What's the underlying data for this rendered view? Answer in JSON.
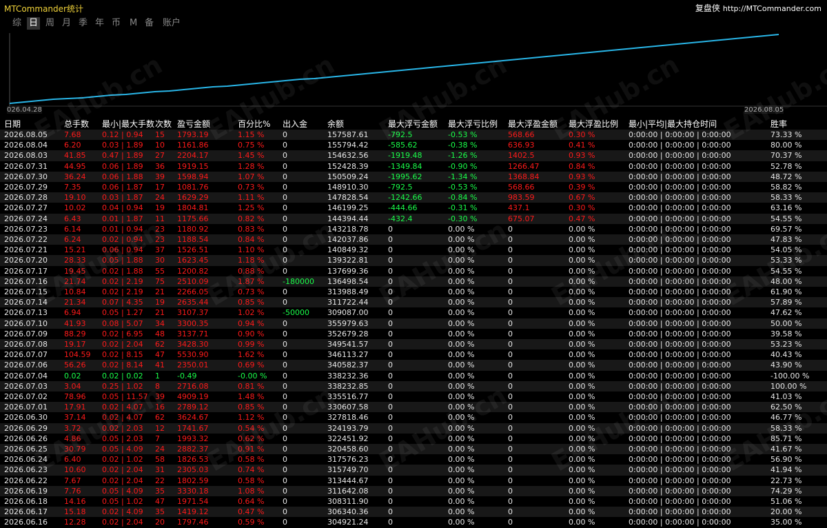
{
  "app": {
    "title": "MTCommander统计",
    "brand": "复盘侠",
    "url": "http://MTCommander.com"
  },
  "tabs": [
    {
      "label": "综",
      "active": false
    },
    {
      "label": "日",
      "active": true
    },
    {
      "label": "周",
      "active": false
    },
    {
      "label": "月",
      "active": false
    },
    {
      "label": "季",
      "active": false
    },
    {
      "label": "年",
      "active": false
    },
    {
      "label": "币",
      "active": false
    },
    {
      "label": "M",
      "active": false
    },
    {
      "label": "备",
      "active": false
    },
    {
      "label": "账户",
      "active": false
    }
  ],
  "chart_data": {
    "type": "line",
    "x_start_label": "026.04.28",
    "x_end_label": "2026.08.05",
    "series": [
      {
        "values": [
          0,
          2,
          4,
          6,
          7,
          8,
          10,
          12,
          13,
          15,
          17,
          18,
          20,
          22,
          24,
          25,
          27,
          29,
          31,
          33,
          35,
          36,
          38,
          40,
          42,
          44,
          46,
          48,
          50,
          52,
          54,
          56,
          58,
          60,
          62,
          64,
          66,
          68,
          70,
          72,
          74,
          76,
          78,
          80,
          82,
          84,
          86,
          88,
          90,
          92,
          94,
          96,
          98,
          100
        ]
      }
    ],
    "line_color": "#29b6e8"
  },
  "columns": [
    "日期",
    "总手数",
    "最小|最大手数",
    "次数",
    "盈亏金额",
    "百分比%",
    "出入金",
    "余额",
    "最大浮亏金额",
    "最大浮亏比例",
    "最大浮盈金额",
    "最大浮盈比例",
    "最小|平均|最大持仓时间",
    "胜率"
  ],
  "rows": [
    {
      "date": "2026.08.05",
      "lots": "7.68",
      "minmax": "0.12 | 0.94",
      "count": "15",
      "pnl": "1793.19",
      "pct": "1.15 %",
      "dep": "0",
      "bal": "157587.61",
      "ddAmt": "-792.5",
      "ddPct": "-0.53 %",
      "fpAmt": "568.66",
      "fpPct": "0.30 %",
      "hold": "0:00:00 | 0:00:00 | 0:00:00",
      "win": "73.33 %",
      "c": "red",
      "f": "red"
    },
    {
      "date": "2026.08.04",
      "lots": "6.20",
      "minmax": "0.03 | 1.89",
      "count": "10",
      "pnl": "1161.86",
      "pct": "0.75 %",
      "dep": "0",
      "bal": "155794.42",
      "ddAmt": "-585.62",
      "ddPct": "-0.38 %",
      "fpAmt": "636.93",
      "fpPct": "0.41 %",
      "hold": "0:00:00 | 0:00:00 | 0:00:00",
      "win": "80.00 %",
      "c": "red",
      "f": "red"
    },
    {
      "date": "2026.08.03",
      "lots": "41.85",
      "minmax": "0.47 | 1.89",
      "count": "27",
      "pnl": "2204.17",
      "pct": "1.45 %",
      "dep": "0",
      "bal": "154632.56",
      "ddAmt": "-1919.48",
      "ddPct": "-1.26 %",
      "fpAmt": "1402.5",
      "fpPct": "0.93 %",
      "hold": "0:00:00 | 0:00:00 | 0:00:00",
      "win": "70.37 %",
      "c": "red",
      "f": "red"
    },
    {
      "date": "2026.07.31",
      "lots": "44.95",
      "minmax": "0.06 | 1.89",
      "count": "36",
      "pnl": "1919.15",
      "pct": "1.28 %",
      "dep": "0",
      "bal": "152428.39",
      "ddAmt": "-1349.84",
      "ddPct": "-0.90 %",
      "fpAmt": "1266.47",
      "fpPct": "0.84 %",
      "hold": "0:00:00 | 0:00:00 | 0:00:00",
      "win": "52.78 %",
      "c": "red",
      "f": "red"
    },
    {
      "date": "2026.07.30",
      "lots": "36.24",
      "minmax": "0.06 | 1.88",
      "count": "39",
      "pnl": "1598.94",
      "pct": "1.07 %",
      "dep": "0",
      "bal": "150509.24",
      "ddAmt": "-1995.62",
      "ddPct": "-1.34 %",
      "fpAmt": "1368.84",
      "fpPct": "0.93 %",
      "hold": "0:00:00 | 0:00:00 | 0:00:00",
      "win": "48.72 %",
      "c": "red",
      "f": "red"
    },
    {
      "date": "2026.07.29",
      "lots": "7.35",
      "minmax": "0.06 | 1.87",
      "count": "17",
      "pnl": "1081.76",
      "pct": "0.73 %",
      "dep": "0",
      "bal": "148910.30",
      "ddAmt": "-792.5",
      "ddPct": "-0.53 %",
      "fpAmt": "568.66",
      "fpPct": "0.39 %",
      "hold": "0:00:00 | 0:00:00 | 0:00:00",
      "win": "58.82 %",
      "c": "red",
      "f": "red"
    },
    {
      "date": "2026.07.28",
      "lots": "19.10",
      "minmax": "0.03 | 1.87",
      "count": "24",
      "pnl": "1629.29",
      "pct": "1.11 %",
      "dep": "0",
      "bal": "147828.54",
      "ddAmt": "-1242.66",
      "ddPct": "-0.84 %",
      "fpAmt": "983.59",
      "fpPct": "0.67 %",
      "hold": "0:00:00 | 0:00:00 | 0:00:00",
      "win": "58.33 %",
      "c": "red",
      "f": "red"
    },
    {
      "date": "2026.07.27",
      "lots": "10.02",
      "minmax": "0.04 | 0.94",
      "count": "19",
      "pnl": "1804.81",
      "pct": "1.25 %",
      "dep": "0",
      "bal": "146199.25",
      "ddAmt": "-444.66",
      "ddPct": "-0.31 %",
      "fpAmt": "437.1",
      "fpPct": "0.30 %",
      "hold": "0:00:00 | 0:00:00 | 0:00:00",
      "win": "63.16 %",
      "c": "red",
      "f": "red"
    },
    {
      "date": "2026.07.24",
      "lots": "6.43",
      "minmax": "0.01 | 1.87",
      "count": "11",
      "pnl": "1175.66",
      "pct": "0.82 %",
      "dep": "0",
      "bal": "144394.44",
      "ddAmt": "-432.4",
      "ddPct": "-0.30 %",
      "fpAmt": "675.07",
      "fpPct": "0.47 %",
      "hold": "0:00:00 | 0:00:00 | 0:00:00",
      "win": "54.55 %",
      "c": "red",
      "f": "red"
    },
    {
      "date": "2026.07.23",
      "lots": "6.14",
      "minmax": "0.01 | 0.94",
      "count": "23",
      "pnl": "1180.92",
      "pct": "0.83 %",
      "dep": "0",
      "bal": "143218.78",
      "ddAmt": "0",
      "ddPct": "0.00 %",
      "fpAmt": "0",
      "fpPct": "0.00 %",
      "hold": "0:00:00 | 0:00:00 | 0:00:00",
      "win": "69.57 %",
      "c": "red",
      "f": "white"
    },
    {
      "date": "2026.07.22",
      "lots": "6.24",
      "minmax": "0.02 | 0.94",
      "count": "23",
      "pnl": "1188.54",
      "pct": "0.84 %",
      "dep": "0",
      "bal": "142037.86",
      "ddAmt": "0",
      "ddPct": "0.00 %",
      "fpAmt": "0",
      "fpPct": "0.00 %",
      "hold": "0:00:00 | 0:00:00 | 0:00:00",
      "win": "47.83 %",
      "c": "red",
      "f": "white"
    },
    {
      "date": "2026.07.21",
      "lots": "15.21",
      "minmax": "0.06 | 0.94",
      "count": "37",
      "pnl": "1526.51",
      "pct": "1.10 %",
      "dep": "0",
      "bal": "140849.32",
      "ddAmt": "0",
      "ddPct": "0.00 %",
      "fpAmt": "0",
      "fpPct": "0.00 %",
      "hold": "0:00:00 | 0:00:00 | 0:00:00",
      "win": "54.05 %",
      "c": "red",
      "f": "white"
    },
    {
      "date": "2026.07.20",
      "lots": "28.33",
      "minmax": "0.05 | 1.88",
      "count": "30",
      "pnl": "1623.45",
      "pct": "1.18 %",
      "dep": "0",
      "bal": "139322.81",
      "ddAmt": "0",
      "ddPct": "0.00 %",
      "fpAmt": "0",
      "fpPct": "0.00 %",
      "hold": "0:00:00 | 0:00:00 | 0:00:00",
      "win": "53.33 %",
      "c": "red",
      "f": "white"
    },
    {
      "date": "2026.07.17",
      "lots": "19.45",
      "minmax": "0.02 | 1.88",
      "count": "55",
      "pnl": "1200.82",
      "pct": "0.88 %",
      "dep": "0",
      "bal": "137699.36",
      "ddAmt": "0",
      "ddPct": "0.00 %",
      "fpAmt": "0",
      "fpPct": "0.00 %",
      "hold": "0:00:00 | 0:00:00 | 0:00:00",
      "win": "54.55 %",
      "c": "red",
      "f": "white"
    },
    {
      "date": "2026.07.16",
      "lots": "21.74",
      "minmax": "0.02 | 2.19",
      "count": "75",
      "pnl": "2510.09",
      "pct": "1.87 %",
      "dep": "-180000",
      "bal": "136498.54",
      "ddAmt": "0",
      "ddPct": "0.00 %",
      "fpAmt": "0",
      "fpPct": "0.00 %",
      "hold": "0:00:00 | 0:00:00 | 0:00:00",
      "win": "48.00 %",
      "c": "red",
      "f": "white",
      "depColor": "green"
    },
    {
      "date": "2026.07.15",
      "lots": "10.84",
      "minmax": "0.02 | 2.19",
      "count": "21",
      "pnl": "2266.05",
      "pct": "0.73 %",
      "dep": "0",
      "bal": "313988.49",
      "ddAmt": "0",
      "ddPct": "0.00 %",
      "fpAmt": "0",
      "fpPct": "0.00 %",
      "hold": "0:00:00 | 0:00:00 | 0:00:00",
      "win": "61.90 %",
      "c": "red",
      "f": "white"
    },
    {
      "date": "2026.07.14",
      "lots": "21.34",
      "minmax": "0.07 | 4.35",
      "count": "19",
      "pnl": "2635.44",
      "pct": "0.85 %",
      "dep": "0",
      "bal": "311722.44",
      "ddAmt": "0",
      "ddPct": "0.00 %",
      "fpAmt": "0",
      "fpPct": "0.00 %",
      "hold": "0:00:00 | 0:00:00 | 0:00:00",
      "win": "57.89 %",
      "c": "red",
      "f": "white"
    },
    {
      "date": "2026.07.13",
      "lots": "6.94",
      "minmax": "0.05 | 1.27",
      "count": "21",
      "pnl": "3107.37",
      "pct": "1.02 %",
      "dep": "-50000",
      "bal": "309087.00",
      "ddAmt": "0",
      "ddPct": "0.00 %",
      "fpAmt": "0",
      "fpPct": "0.00 %",
      "hold": "0:00:00 | 0:00:00 | 0:00:00",
      "win": "47.62 %",
      "c": "red",
      "f": "white",
      "depColor": "green"
    },
    {
      "date": "2026.07.10",
      "lots": "41.93",
      "minmax": "0.08 | 5.07",
      "count": "34",
      "pnl": "3300.35",
      "pct": "0.94 %",
      "dep": "0",
      "bal": "355979.63",
      "ddAmt": "0",
      "ddPct": "0.00 %",
      "fpAmt": "0",
      "fpPct": "0.00 %",
      "hold": "0:00:00 | 0:00:00 | 0:00:00",
      "win": "50.00 %",
      "c": "red",
      "f": "white"
    },
    {
      "date": "2026.07.09",
      "lots": "88.29",
      "minmax": "0.02 | 6.95",
      "count": "48",
      "pnl": "3137.71",
      "pct": "0.90 %",
      "dep": "0",
      "bal": "352679.28",
      "ddAmt": "0",
      "ddPct": "0.00 %",
      "fpAmt": "0",
      "fpPct": "0.00 %",
      "hold": "0:00:00 | 0:00:00 | 0:00:00",
      "win": "39.58 %",
      "c": "red",
      "f": "white"
    },
    {
      "date": "2026.07.08",
      "lots": "19.17",
      "minmax": "0.02 | 2.04",
      "count": "62",
      "pnl": "3428.30",
      "pct": "0.99 %",
      "dep": "0",
      "bal": "349541.57",
      "ddAmt": "0",
      "ddPct": "0.00 %",
      "fpAmt": "0",
      "fpPct": "0.00 %",
      "hold": "0:00:00 | 0:00:00 | 0:00:00",
      "win": "53.23 %",
      "c": "red",
      "f": "white"
    },
    {
      "date": "2026.07.07",
      "lots": "104.59",
      "minmax": "0.02 | 8.15",
      "count": "47",
      "pnl": "5530.90",
      "pct": "1.62 %",
      "dep": "0",
      "bal": "346113.27",
      "ddAmt": "0",
      "ddPct": "0.00 %",
      "fpAmt": "0",
      "fpPct": "0.00 %",
      "hold": "0:00:00 | 0:00:00 | 0:00:00",
      "win": "40.43 %",
      "c": "red",
      "f": "white"
    },
    {
      "date": "2026.07.06",
      "lots": "56.26",
      "minmax": "0.02 | 8.14",
      "count": "41",
      "pnl": "2350.01",
      "pct": "0.69 %",
      "dep": "0",
      "bal": "340582.37",
      "ddAmt": "0",
      "ddPct": "0.00 %",
      "fpAmt": "0",
      "fpPct": "0.00 %",
      "hold": "0:00:00 | 0:00:00 | 0:00:00",
      "win": "43.90 %",
      "c": "red",
      "f": "white"
    },
    {
      "date": "2026.07.04",
      "lots": "0.02",
      "minmax": "0.02 | 0.02",
      "count": "1",
      "pnl": "-0.49",
      "pct": "-0.00 %",
      "dep": "0",
      "bal": "338232.36",
      "ddAmt": "0",
      "ddPct": "0.00 %",
      "fpAmt": "0",
      "fpPct": "0.00 %",
      "hold": "0:00:00 | 0:00:00 | 0:00:00",
      "win": "-100.00 %",
      "c": "green",
      "f": "white"
    },
    {
      "date": "2026.07.03",
      "lots": "3.04",
      "minmax": "0.25 | 1.02",
      "count": "8",
      "pnl": "2716.08",
      "pct": "0.81 %",
      "dep": "0",
      "bal": "338232.85",
      "ddAmt": "0",
      "ddPct": "0.00 %",
      "fpAmt": "0",
      "fpPct": "0.00 %",
      "hold": "0:00:00 | 0:00:00 | 0:00:00",
      "win": "100.00 %",
      "c": "red",
      "f": "white"
    },
    {
      "date": "2026.07.02",
      "lots": "78.96",
      "minmax": "0.05 | 11.57",
      "count": "39",
      "pnl": "4909.19",
      "pct": "1.48 %",
      "dep": "0",
      "bal": "335516.77",
      "ddAmt": "0",
      "ddPct": "0.00 %",
      "fpAmt": "0",
      "fpPct": "0.00 %",
      "hold": "0:00:00 | 0:00:00 | 0:00:00",
      "win": "41.03 %",
      "c": "red",
      "f": "white"
    },
    {
      "date": "2026.07.01",
      "lots": "17.91",
      "minmax": "0.02 | 4.07",
      "count": "16",
      "pnl": "2789.12",
      "pct": "0.85 %",
      "dep": "0",
      "bal": "330607.58",
      "ddAmt": "0",
      "ddPct": "0.00 %",
      "fpAmt": "0",
      "fpPct": "0.00 %",
      "hold": "0:00:00 | 0:00:00 | 0:00:00",
      "win": "62.50 %",
      "c": "red",
      "f": "white"
    },
    {
      "date": "2026.06.30",
      "lots": "37.14",
      "minmax": "0.02 | 4.07",
      "count": "62",
      "pnl": "3624.67",
      "pct": "1.12 %",
      "dep": "0",
      "bal": "327818.46",
      "ddAmt": "0",
      "ddPct": "0.00 %",
      "fpAmt": "0",
      "fpPct": "0.00 %",
      "hold": "0:00:00 | 0:00:00 | 0:00:00",
      "win": "46.77 %",
      "c": "red",
      "f": "white"
    },
    {
      "date": "2026.06.29",
      "lots": "3.72",
      "minmax": "0.02 | 2.03",
      "count": "12",
      "pnl": "1741.67",
      "pct": "0.54 %",
      "dep": "0",
      "bal": "324193.79",
      "ddAmt": "0",
      "ddPct": "0.00 %",
      "fpAmt": "0",
      "fpPct": "0.00 %",
      "hold": "0:00:00 | 0:00:00 | 0:00:00",
      "win": "58.33 %",
      "c": "red",
      "f": "white"
    },
    {
      "date": "2026.06.26",
      "lots": "4.86",
      "minmax": "0.05 | 2.03",
      "count": "7",
      "pnl": "1993.32",
      "pct": "0.62 %",
      "dep": "0",
      "bal": "322451.92",
      "ddAmt": "0",
      "ddPct": "0.00 %",
      "fpAmt": "0",
      "fpPct": "0.00 %",
      "hold": "0:00:00 | 0:00:00 | 0:00:00",
      "win": "85.71 %",
      "c": "red",
      "f": "white"
    },
    {
      "date": "2026.06.25",
      "lots": "30.79",
      "minmax": "0.05 | 4.09",
      "count": "24",
      "pnl": "2882.37",
      "pct": "0.91 %",
      "dep": "0",
      "bal": "320458.60",
      "ddAmt": "0",
      "ddPct": "0.00 %",
      "fpAmt": "0",
      "fpPct": "0.00 %",
      "hold": "0:00:00 | 0:00:00 | 0:00:00",
      "win": "41.67 %",
      "c": "red",
      "f": "white"
    },
    {
      "date": "2026.06.24",
      "lots": "6.40",
      "minmax": "0.02 | 1.02",
      "count": "58",
      "pnl": "1826.53",
      "pct": "0.58 %",
      "dep": "0",
      "bal": "317576.23",
      "ddAmt": "0",
      "ddPct": "0.00 %",
      "fpAmt": "0",
      "fpPct": "0.00 %",
      "hold": "0:00:00 | 0:00:00 | 0:00:00",
      "win": "56.90 %",
      "c": "red",
      "f": "white"
    },
    {
      "date": "2026.06.23",
      "lots": "10.60",
      "minmax": "0.02 | 2.04",
      "count": "31",
      "pnl": "2305.03",
      "pct": "0.74 %",
      "dep": "0",
      "bal": "315749.70",
      "ddAmt": "0",
      "ddPct": "0.00 %",
      "fpAmt": "0",
      "fpPct": "0.00 %",
      "hold": "0:00:00 | 0:00:00 | 0:00:00",
      "win": "41.94 %",
      "c": "red",
      "f": "white"
    },
    {
      "date": "2026.06.22",
      "lots": "7.67",
      "minmax": "0.02 | 2.04",
      "count": "22",
      "pnl": "1802.59",
      "pct": "0.58 %",
      "dep": "0",
      "bal": "313444.67",
      "ddAmt": "0",
      "ddPct": "0.00 %",
      "fpAmt": "0",
      "fpPct": "0.00 %",
      "hold": "0:00:00 | 0:00:00 | 0:00:00",
      "win": "22.73 %",
      "c": "red",
      "f": "white"
    },
    {
      "date": "2026.06.19",
      "lots": "7.76",
      "minmax": "0.05 | 4.09",
      "count": "35",
      "pnl": "3330.18",
      "pct": "1.08 %",
      "dep": "0",
      "bal": "311642.08",
      "ddAmt": "0",
      "ddPct": "0.00 %",
      "fpAmt": "0",
      "fpPct": "0.00 %",
      "hold": "0:00:00 | 0:00:00 | 0:00:00",
      "win": "74.29 %",
      "c": "red",
      "f": "white"
    },
    {
      "date": "2026.06.18",
      "lots": "14.16",
      "minmax": "0.05 | 1.02",
      "count": "47",
      "pnl": "1971.54",
      "pct": "0.64 %",
      "dep": "0",
      "bal": "308311.90",
      "ddAmt": "0",
      "ddPct": "0.00 %",
      "fpAmt": "0",
      "fpPct": "0.00 %",
      "hold": "0:00:00 | 0:00:00 | 0:00:00",
      "win": "51.06 %",
      "c": "red",
      "f": "white"
    },
    {
      "date": "2026.06.17",
      "lots": "15.18",
      "minmax": "0.02 | 4.09",
      "count": "35",
      "pnl": "1419.12",
      "pct": "0.47 %",
      "dep": "0",
      "bal": "306340.36",
      "ddAmt": "0",
      "ddPct": "0.00 %",
      "fpAmt": "0",
      "fpPct": "0.00 %",
      "hold": "0:00:00 | 0:00:00 | 0:00:00",
      "win": "20.00 %",
      "c": "red",
      "f": "white"
    },
    {
      "date": "2026.06.16",
      "lots": "12.28",
      "minmax": "0.02 | 2.04",
      "count": "20",
      "pnl": "1797.46",
      "pct": "0.59 %",
      "dep": "0",
      "bal": "304921.24",
      "ddAmt": "0",
      "ddPct": "0.00 %",
      "fpAmt": "0",
      "fpPct": "0.00 %",
      "hold": "0:00:00 | 0:00:00 | 0:00:00",
      "win": "35.00 %",
      "c": "red",
      "f": "white"
    }
  ],
  "watermark": "EAHub.cn"
}
